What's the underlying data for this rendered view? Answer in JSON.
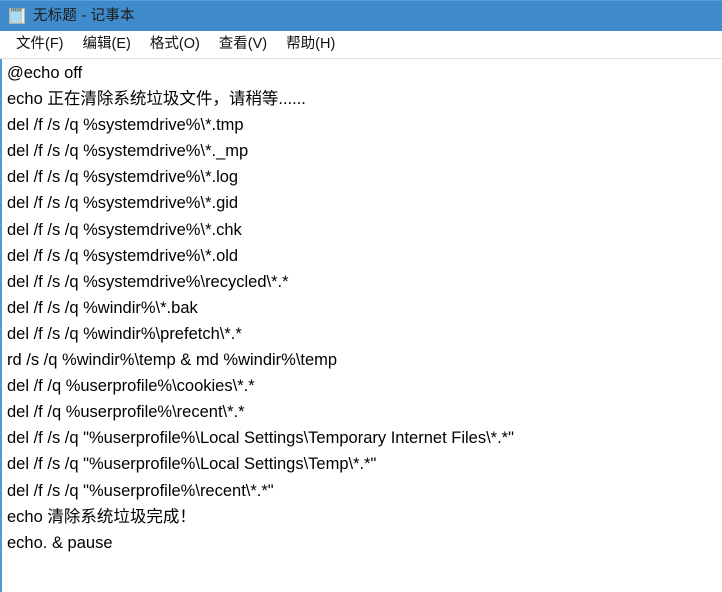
{
  "window": {
    "title": "无标题 - 记事本",
    "app_icon": "notepad-icon",
    "titlebar_color": "#3f8bcc",
    "background_color": "#ffffff"
  },
  "menubar": {
    "items": [
      {
        "label": "文件(F)"
      },
      {
        "label": "编辑(E)"
      },
      {
        "label": "格式(O)"
      },
      {
        "label": "查看(V)"
      },
      {
        "label": "帮助(H)"
      }
    ]
  },
  "editor": {
    "text_color": "#000000",
    "lines": [
      "@echo off",
      "echo 正在清除系统垃圾文件，请稍等......",
      "del /f /s /q %systemdrive%\\*.tmp",
      "del /f /s /q %systemdrive%\\*._mp",
      "del /f /s /q %systemdrive%\\*.log",
      "del /f /s /q %systemdrive%\\*.gid",
      "del /f /s /q %systemdrive%\\*.chk",
      "del /f /s /q %systemdrive%\\*.old",
      "del /f /s /q %systemdrive%\\recycled\\*.*",
      "del /f /s /q %windir%\\*.bak",
      "del /f /s /q %windir%\\prefetch\\*.*",
      "rd /s /q %windir%\\temp & md %windir%\\temp",
      "del /f /q %userprofile%\\cookies\\*.*",
      "del /f /q %userprofile%\\recent\\*.*",
      "del /f /s /q \"%userprofile%\\Local Settings\\Temporary Internet Files\\*.*\"",
      "del /f /s /q \"%userprofile%\\Local Settings\\Temp\\*.*\"",
      "del /f /s /q \"%userprofile%\\recent\\*.*\"",
      "echo 清除系统垃圾完成！",
      "echo. & pause"
    ]
  }
}
